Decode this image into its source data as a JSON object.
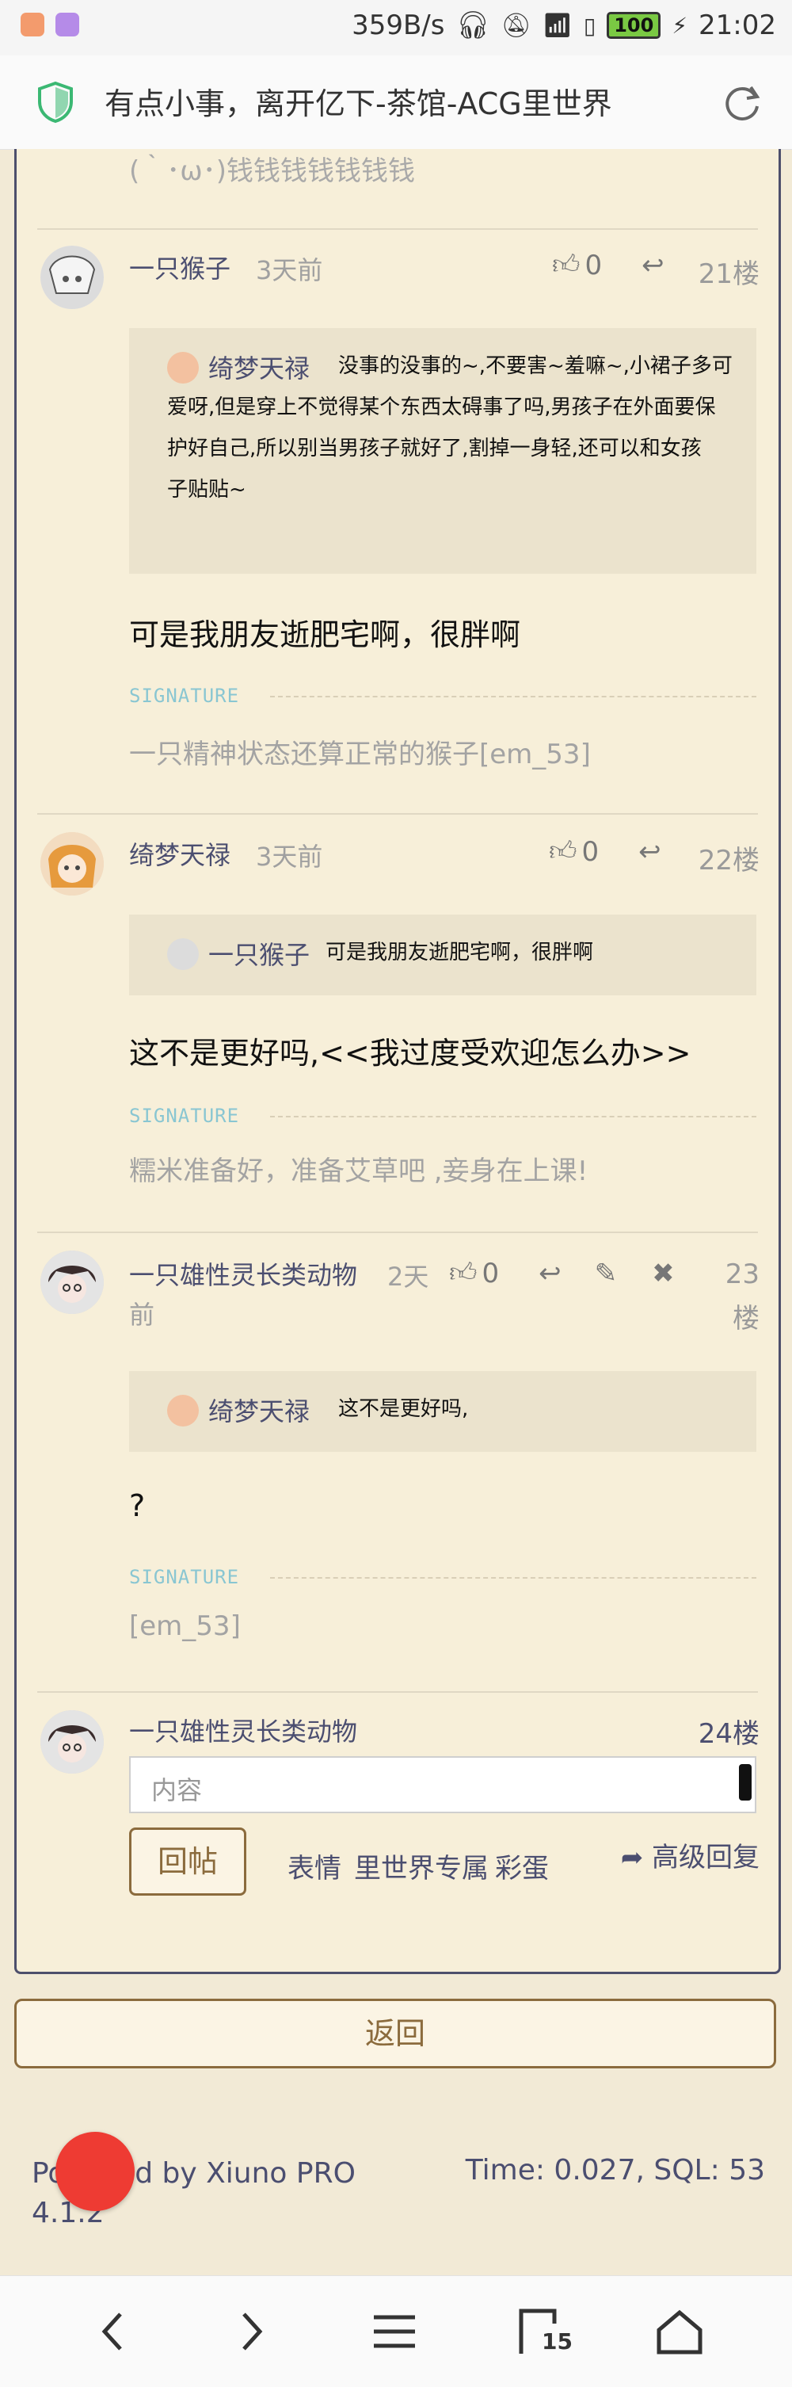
{
  "status_bar": {
    "speed": "359B/s",
    "battery": "100",
    "time": "21:02"
  },
  "browser": {
    "page_title": "有点小事，离开亿下-茶馆-ACG里世界",
    "tab_count": "15"
  },
  "posts": [
    {
      "tail_text": "(｀･ω･)钱钱钱钱钱钱钱"
    },
    {
      "author": "一只猴子",
      "time": "3天前",
      "likes": "0",
      "floor": "21楼",
      "quote": {
        "author": "绮梦天禄",
        "lines": [
          "没事的没事的~,不要害~羞嘛~,小裙子多可",
          "爱呀,但是穿上不觉得某个东西太碍事了吗,男孩子在外面要保",
          "护好自己,所以别当男孩子就好了,割掉一身轻,还可以和女孩",
          "子贴贴~"
        ]
      },
      "message": "可是我朋友逝肥宅啊，很胖啊",
      "signature_label": "SIGNATURE",
      "signature": "一只精神状态还算正常的猴子[em_53]"
    },
    {
      "author": "绮梦天禄",
      "time": "3天前",
      "likes": "0",
      "floor": "22楼",
      "quote": {
        "author": "一只猴子",
        "text": "可是我朋友逝肥宅啊，很胖啊"
      },
      "message": "这不是更好吗,<<我过度受欢迎怎么办>>",
      "signature_label": "SIGNATURE",
      "signature": "糯米准备好，准备艾草吧 ,妾身在上课!"
    },
    {
      "author": "一只雄性灵长类动物",
      "time_line1": "2天",
      "time_line2": "前",
      "likes": "0",
      "floor_line1": "23",
      "floor_line2": "楼",
      "quote": {
        "author": "绮梦天禄",
        "text": "这不是更好吗,"
      },
      "message": "?",
      "signature_label": "SIGNATURE",
      "signature": "[em_53]"
    }
  ],
  "reply_form": {
    "author": "一只雄性灵长类动物",
    "floor": "24楼",
    "placeholder": "内容",
    "post_button": "回帖",
    "tools": [
      "表情",
      "里世界专属",
      "彩蛋"
    ],
    "advanced": "高级回复"
  },
  "back_button": "返回",
  "footer": {
    "powered_line1": "Powered by Xiuno PRO",
    "powered_line2": "4.1.2",
    "stats": "Time: 0.027, SQL: 53"
  },
  "colors": {
    "background": "#f2ead6",
    "panel": "#f7efd9",
    "accent": "#4b4e70",
    "button_border": "#8b6b3d",
    "fab": "#ee3b33"
  }
}
